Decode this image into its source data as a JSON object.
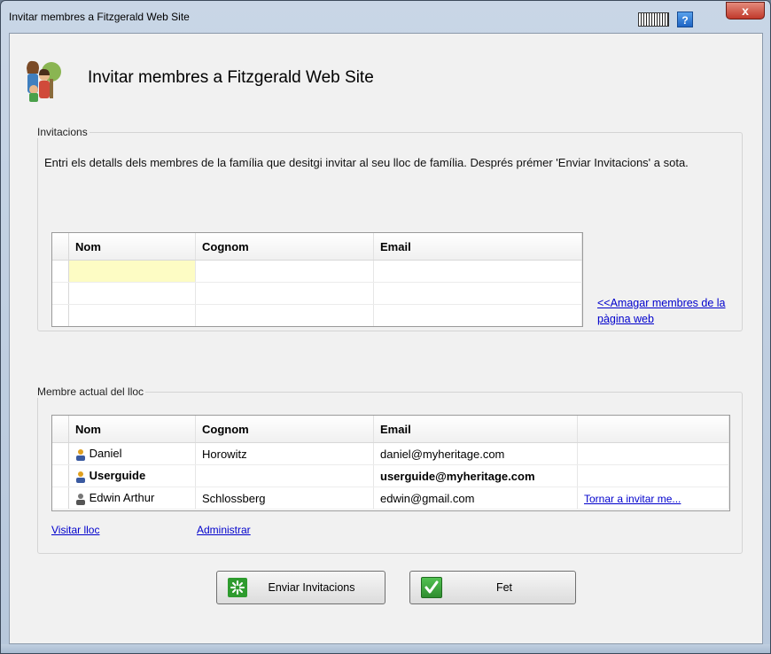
{
  "window": {
    "title": "Invitar membres a Fitzgerald Web Site",
    "close_label": "x",
    "help_label": "?"
  },
  "page": {
    "title": "Invitar membres a Fitzgerald Web Site"
  },
  "invitations": {
    "legend": "Invitacions",
    "description": "Entri els detalls dels membres de la família que desitgi invitar al seu lloc de família. Després prémer 'Enviar Invitacions' a sota.",
    "columns": [
      "Nom",
      "Cognom",
      "Email"
    ],
    "rows": [
      [
        "",
        "",
        ""
      ],
      [
        "",
        "",
        ""
      ],
      [
        "",
        "",
        ""
      ]
    ],
    "hide_link": "<<Amagar membres de la pàgina web"
  },
  "members": {
    "legend": "Membre actual del lloc",
    "columns": [
      "Nom",
      "Cognom",
      "Email",
      ""
    ],
    "rows": [
      {
        "nom": "Daniel",
        "cognom": "Horowitz",
        "email": "daniel@myheritage.com",
        "action": "",
        "bold": false,
        "icon": "person-gold-icon"
      },
      {
        "nom": "Userguide",
        "cognom": "",
        "email": "userguide@myheritage.com",
        "action": "",
        "bold": true,
        "icon": "person-gold-icon"
      },
      {
        "nom": "Edwin Arthur",
        "cognom": "Schlossberg",
        "email": "edwin@gmail.com",
        "action": "Tornar a invitar me...",
        "bold": false,
        "icon": "person-gray-icon"
      }
    ],
    "visit_link": "Visitar lloc",
    "admin_link": "Administrar"
  },
  "buttons": {
    "send": "Enviar Invitacions",
    "done": "Fet"
  },
  "colors": {
    "link": "#0000cc",
    "selected_cell": "#fdfcc4",
    "send_icon": "#2e9b2e",
    "done_icon": "#3fae3f"
  }
}
